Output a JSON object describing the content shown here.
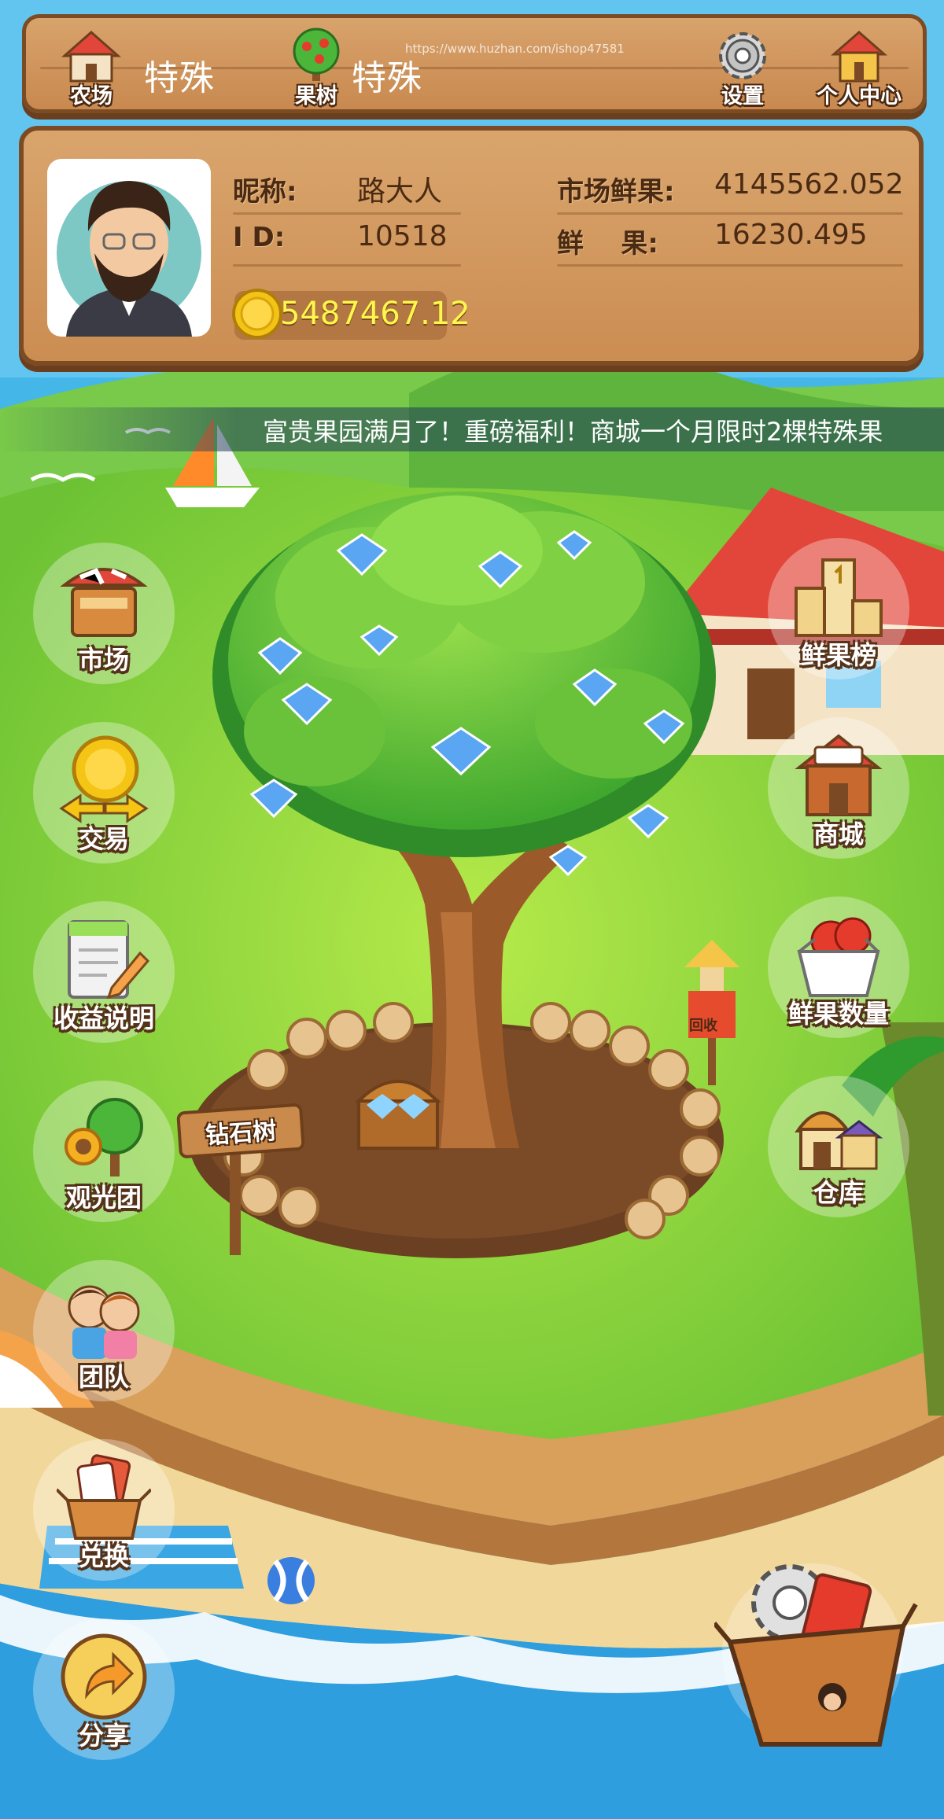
{
  "topbar": {
    "farm": {
      "label": "农场",
      "value": "特殊"
    },
    "fruit_tree": {
      "label": "果树",
      "value": "特殊"
    },
    "settings": {
      "label": "设置"
    },
    "user_center": {
      "label": "个人中心"
    },
    "watermark": "https://www.huzhan.com/ishop47581"
  },
  "profile": {
    "nickname_label": "昵称:",
    "nickname": "路大人",
    "id_label": "I D:",
    "id": "10518",
    "market_fruit_label": "市场鲜果:",
    "market_fruit": "4145562.052",
    "fruit_label": "鲜    果:",
    "fruit": "16230.495",
    "coins": "5487467.12"
  },
  "marquee": "富贵果园满月了！重磅福利！商城一个月限时2棵特殊果",
  "left_menu": [
    {
      "label": "市场",
      "icon": "market-stall-icon"
    },
    {
      "label": "交易",
      "icon": "coin-exchange-icon"
    },
    {
      "label": "收益说明",
      "icon": "notepad-icon"
    },
    {
      "label": "观光团",
      "icon": "sightseeing-tree-icon"
    },
    {
      "label": "团队",
      "icon": "team-kids-icon"
    },
    {
      "label": "兑换",
      "icon": "exchange-box-icon"
    },
    {
      "label": "分享",
      "icon": "share-arrow-icon"
    }
  ],
  "right_menu": [
    {
      "label": "鲜果榜",
      "icon": "podium-icon"
    },
    {
      "label": "商城",
      "icon": "shop-icon"
    },
    {
      "label": "鲜果数量",
      "icon": "fruit-box-icon"
    },
    {
      "label": "仓库",
      "icon": "warehouse-icon"
    }
  ],
  "scene": {
    "tree_sign": "钻石树",
    "recycle_tag": "回收"
  },
  "colors": {
    "wood_panel": "#cf9358",
    "wood_border": "#7c4a23",
    "sky": "#4fb6e6",
    "grass": "#8fd63a",
    "coin_text": "#fff74c"
  }
}
